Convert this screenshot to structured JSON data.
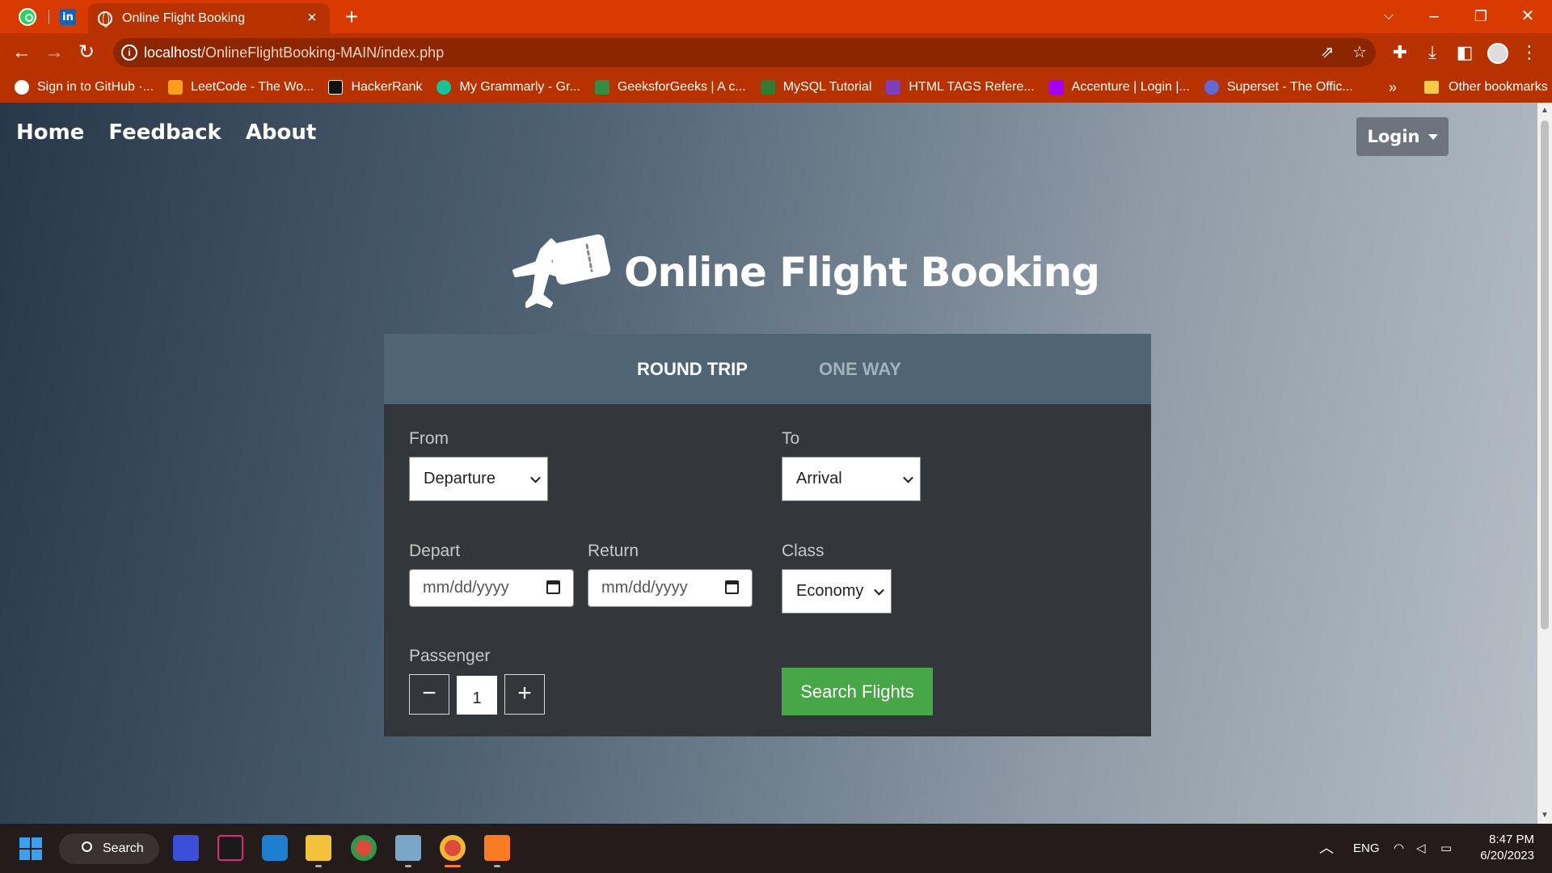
{
  "browser": {
    "tab_title": "Online Flight Booking",
    "url_host": "localhost",
    "url_path": "/OnlineFlightBooking-MAIN/index.php",
    "bookmarks": [
      {
        "label": "Sign in to GitHub ·...",
        "icon": "github-icon",
        "color": "#ffffff"
      },
      {
        "label": "LeetCode - The Wo...",
        "icon": "leetcode-icon",
        "color": "#f89f1b"
      },
      {
        "label": "HackerRank",
        "icon": "hackerrank-icon",
        "color": "#111111"
      },
      {
        "label": "My Grammarly - Gr...",
        "icon": "grammarly-icon",
        "color": "#15c39a"
      },
      {
        "label": "GeeksforGeeks | A c...",
        "icon": "geeksforgeeks-icon",
        "color": "#2f8d46"
      },
      {
        "label": "MySQL Tutorial",
        "icon": "mysql-icon",
        "color": "#2e7d32"
      },
      {
        "label": "HTML TAGS Refere...",
        "icon": "html-tags-icon",
        "color": "#7b3fbf"
      },
      {
        "label": "Accenture | Login |...",
        "icon": "accenture-icon",
        "color": "#a100ff"
      },
      {
        "label": "Superset - The Offic...",
        "icon": "superset-icon",
        "color": "#5f6ad8"
      }
    ],
    "bookmarks_more": "»",
    "other_bookmarks": "Other bookmarks"
  },
  "site": {
    "nav": [
      {
        "label": "Home"
      },
      {
        "label": "Feedback"
      },
      {
        "label": "About"
      }
    ],
    "login_label": "Login",
    "brand_title": "Online Flight Booking"
  },
  "booking": {
    "tabs": {
      "round_trip": "ROUND TRIP",
      "one_way": "ONE WAY"
    },
    "from_label": "From",
    "from_value": "Departure",
    "to_label": "To",
    "to_value": "Arrival",
    "depart_label": "Depart",
    "depart_placeholder": "mm/dd/yyyy",
    "return_label": "Return",
    "return_placeholder": "mm/dd/yyyy",
    "class_label": "Class",
    "class_value": "Economy",
    "passenger_label": "Passenger",
    "passenger_count": "1",
    "minus": "−",
    "plus": "+",
    "search_label": "Search Flights",
    "colors": {
      "search": "#47a747",
      "tabs_bg": "#4f6573",
      "form_bg": "#33373b"
    }
  },
  "taskbar": {
    "search_label": "Search",
    "language": "ENG",
    "time": "8:47 PM",
    "date": "6/20/2023"
  }
}
